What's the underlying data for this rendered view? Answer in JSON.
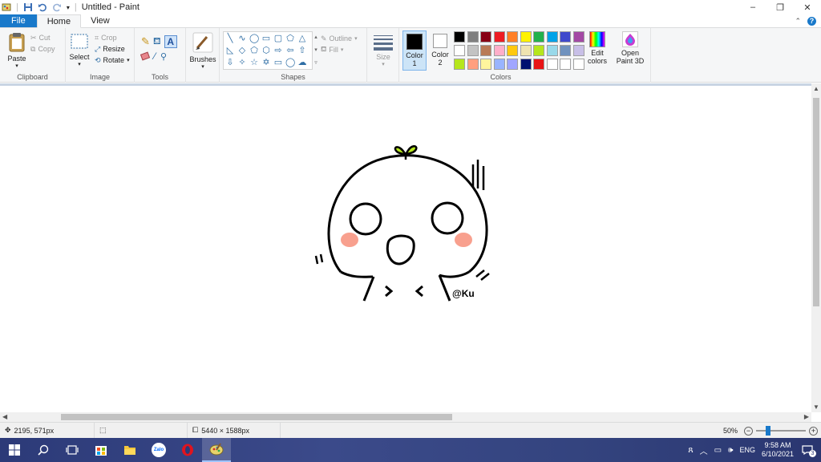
{
  "window": {
    "title": "Untitled - Paint",
    "controls": {
      "minimize": "–",
      "restore": "❐",
      "close": "✕"
    }
  },
  "tabs": [
    {
      "label": "File"
    },
    {
      "label": "Home"
    },
    {
      "label": "View"
    }
  ],
  "ribbon": {
    "clipboard": {
      "label": "Clipboard",
      "paste": "Paste",
      "cut": "Cut",
      "copy": "Copy"
    },
    "image": {
      "label": "Image",
      "select": "Select",
      "crop": "Crop",
      "resize": "Resize",
      "rotate": "Rotate"
    },
    "tools": {
      "label": "Tools",
      "brushes": "Brushes"
    },
    "shapes": {
      "label": "Shapes",
      "outline": "Outline",
      "fill": "Fill"
    },
    "size": {
      "label": "Size"
    },
    "colors": {
      "label": "Colors",
      "color1": "Color 1",
      "color2": "Color 2",
      "edit_colors": "Edit colors",
      "open_paint3d": "Open Paint 3D",
      "color1_value": "#000000",
      "color2_value": "#ffffff",
      "palette_row1": [
        "#000000",
        "#7f7f7f",
        "#880015",
        "#ed1c24",
        "#ff7f27",
        "#fff200",
        "#22b14c",
        "#00a2e8",
        "#3f48cc",
        "#a349a4"
      ],
      "palette_row2": [
        "#ffffff",
        "#c3c3c3",
        "#b97a57",
        "#ffaec9",
        "#ffc90e",
        "#efe4b0",
        "#b5e61d",
        "#99d9ea",
        "#7092be",
        "#c8bfe7"
      ],
      "palette_row3": [
        "#b5e61d",
        "#ff9f7f",
        "#fff59d",
        "#99b4ff",
        "#a0a6ff",
        "#001070",
        "#e81416",
        "#ffffff",
        "#ffffff",
        "#ffffff"
      ]
    }
  },
  "canvas": {
    "watermark": "@Ku"
  },
  "status": {
    "cursor_pos": "2195, 571px",
    "image_size": "5440 × 1588px",
    "zoom": "50%"
  },
  "taskbar": {
    "lang": "ENG",
    "time": "9:58 AM",
    "date": "6/10/2021",
    "notifications": "3"
  }
}
